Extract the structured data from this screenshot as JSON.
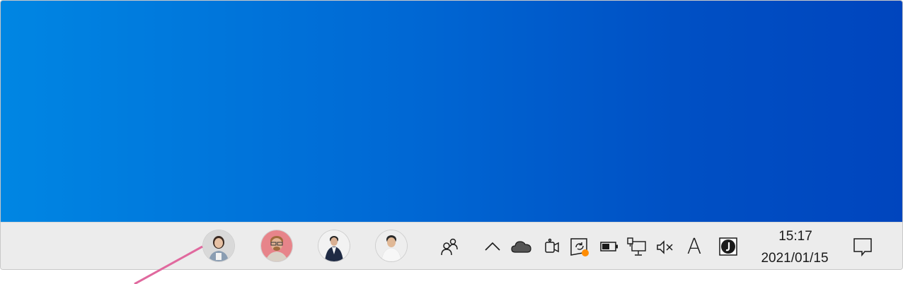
{
  "desktop": {
    "background_colors": [
      "#0086e3",
      "#0045be"
    ]
  },
  "taskbar": {
    "people_avatars": [
      {
        "name": "contact-1",
        "shirt": "#8a9db2",
        "bg": "#d9d9d9",
        "skin": "#e7c1a4",
        "hair": "#3a2a22"
      },
      {
        "name": "contact-2",
        "shirt": "#d9d2c7",
        "bg": "#e7848a",
        "skin": "#e1b394",
        "hair": "#a06a3c"
      },
      {
        "name": "contact-3",
        "shirt": "#1f2b44",
        "bg": "#f2f2f2",
        "skin": "#d9b093",
        "hair": "#222222"
      },
      {
        "name": "contact-4",
        "shirt": "#f7f7f7",
        "bg": "#eeeeee",
        "skin": "#e0b896",
        "hair": "#2a2a2a"
      }
    ],
    "icons": [
      "people-icon",
      "chevron-up-icon",
      "onedrive-cloud-icon",
      "webcam-icon",
      "update-sync-icon",
      "battery-icon",
      "network-icon",
      "volume-muted-icon",
      "ime-letter-icon",
      "app-j-icon",
      "notification-icon"
    ],
    "ime_letter": "A",
    "clock": {
      "time": "15:17",
      "date": "2021/01/15"
    },
    "badge_color": "#ff8c00"
  },
  "annotation": {
    "color": "#e0699e"
  }
}
